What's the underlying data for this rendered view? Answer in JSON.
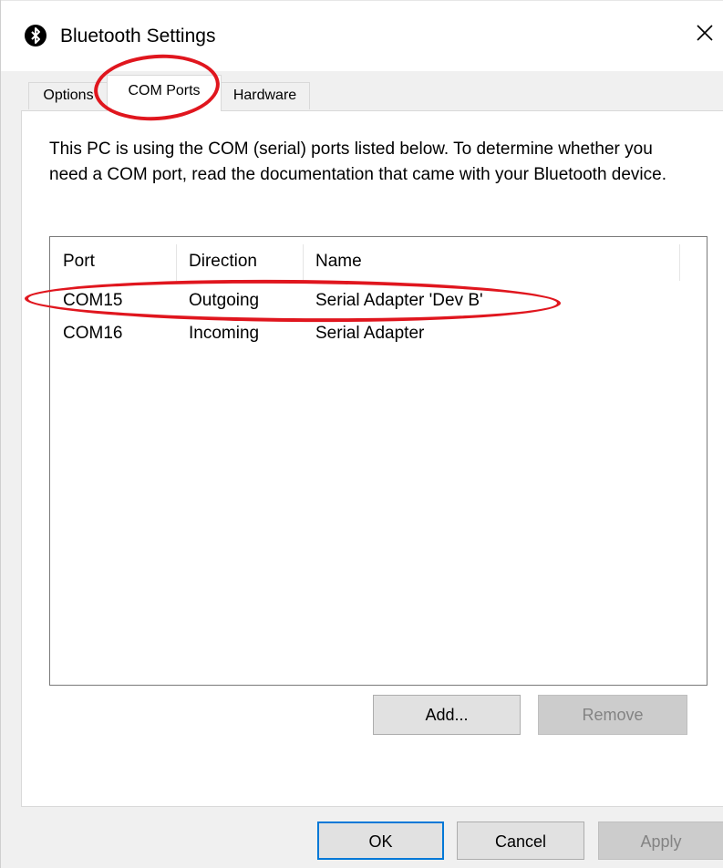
{
  "window": {
    "title": "Bluetooth Settings",
    "icon": "bluetooth-icon",
    "close_icon": "close-icon"
  },
  "tabs": [
    {
      "label": "Options",
      "active": false
    },
    {
      "label": "COM Ports",
      "active": true
    },
    {
      "label": "Hardware",
      "active": false
    }
  ],
  "panel": {
    "description": "This PC is using the COM (serial) ports listed below. To determine whether you need a COM port, read the documentation that came with your Bluetooth device.",
    "columns": [
      "Port",
      "Direction",
      "Name"
    ],
    "rows": [
      {
        "port": "COM15",
        "direction": "Outgoing",
        "name": "Serial Adapter 'Dev B'"
      },
      {
        "port": "COM16",
        "direction": "Incoming",
        "name": "Serial Adapter"
      }
    ],
    "add_label": "Add...",
    "remove_label": "Remove"
  },
  "footer": {
    "ok_label": "OK",
    "cancel_label": "Cancel",
    "apply_label": "Apply"
  },
  "colors": {
    "annotation": "#e0161e",
    "default_button_border": "#0078d7"
  }
}
